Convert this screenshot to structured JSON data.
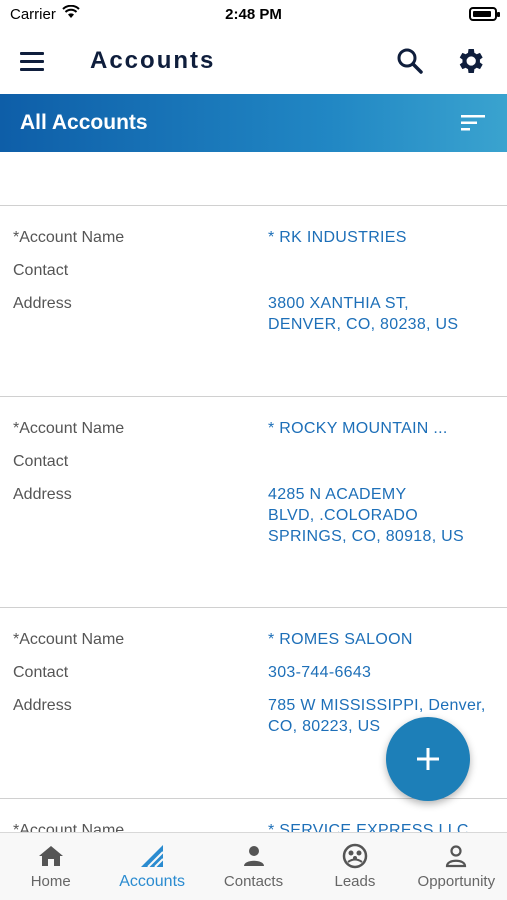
{
  "status_bar": {
    "carrier": "Carrier",
    "time": "2:48 PM",
    "battery_level": 0.9
  },
  "header": {
    "title": "Accounts",
    "icons": [
      "menu-icon",
      "search-icon",
      "gear-icon"
    ]
  },
  "list_header": {
    "title": "All Accounts",
    "icon": "sort-icon"
  },
  "labels": {
    "account_name": "*Account Name",
    "contact": "Contact",
    "address": "Address"
  },
  "accounts": [
    {
      "name": "* RK INDUSTRIES",
      "contact": "",
      "address": "3800 XANTHIA ST,\nDENVER, CO, 80238, US"
    },
    {
      "name": "* ROCKY MOUNTAIN ...",
      "contact": "",
      "address": "4285 N ACADEMY\nBLVD, .COLORADO\nSPRINGS, CO, 80918, US"
    },
    {
      "name": "* ROMES SALOON",
      "contact": "303-744-6643",
      "address": "785 W MISSISSIPPI, Denver,\nCO, 80223, US"
    },
    {
      "name": "* SERVICE EXPRESS LLC",
      "contact": "",
      "address": ""
    }
  ],
  "fab": {
    "icon": "plus-icon"
  },
  "tabs": [
    {
      "label": "Home",
      "icon": "home-icon",
      "active": false
    },
    {
      "label": "Accounts",
      "icon": "accounts-icon",
      "active": true
    },
    {
      "label": "Contacts",
      "icon": "contacts-icon",
      "active": false
    },
    {
      "label": "Leads",
      "icon": "leads-icon",
      "active": false
    },
    {
      "label": "Opportunity",
      "icon": "opportunity-icon",
      "active": false
    }
  ],
  "colors": {
    "accent": "#1d6fb8",
    "header_gradient_start": "#0e5ea8",
    "header_gradient_end": "#3aa3cf",
    "title": "#0f1e3c"
  }
}
